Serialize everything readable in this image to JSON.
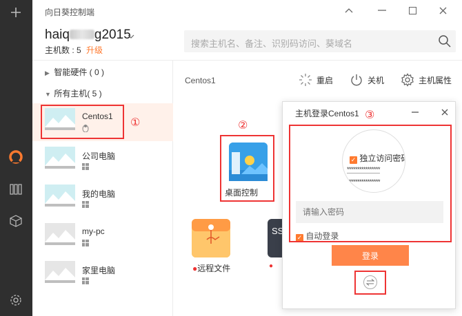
{
  "app": {
    "title": "向日葵控制端"
  },
  "user": {
    "name_prefix": "haiq",
    "name_suffix": "g2015",
    "host_count_label": "主机数 : 5",
    "upgrade_label": "升级"
  },
  "search": {
    "placeholder": "搜索主机名、备注、识别码访问、葵域名"
  },
  "sidebar": {
    "groups": [
      {
        "label": "智能硬件 ( 0 )"
      },
      {
        "label": "所有主机( 5 )"
      }
    ],
    "hosts": [
      {
        "name": "Centos1",
        "os": "linux"
      },
      {
        "name": "公司电脑",
        "os": "windows"
      },
      {
        "name": "我的电脑",
        "os": "windows"
      },
      {
        "name": "my-pc",
        "os": "windows"
      },
      {
        "name": "家里电脑",
        "os": "windows"
      }
    ]
  },
  "main": {
    "host_title": "Centos1",
    "actions": [
      {
        "label": "重启",
        "icon": "restart-icon"
      },
      {
        "label": "关机",
        "icon": "power-icon"
      },
      {
        "label": "主机属性",
        "icon": "gear-icon"
      }
    ],
    "features": [
      {
        "label": "桌面控制"
      },
      {
        "label": "远程文件"
      }
    ],
    "ssh_partial_label": "SS"
  },
  "dialog": {
    "title": "主机登录Centos1",
    "independent_pw_label": "独立访问密码",
    "masked_pw_1": "****************",
    "masked_pw_2": "****************",
    "password_placeholder": "请输入密码",
    "auto_login_label": "自动登录",
    "login_label": "登录"
  },
  "annotations": {
    "n1": "①",
    "n2": "②",
    "n3": "③"
  },
  "colors": {
    "accent": "#ff7a2f",
    "annotation": "#ee3333",
    "selected_row": "#fff1ea"
  }
}
